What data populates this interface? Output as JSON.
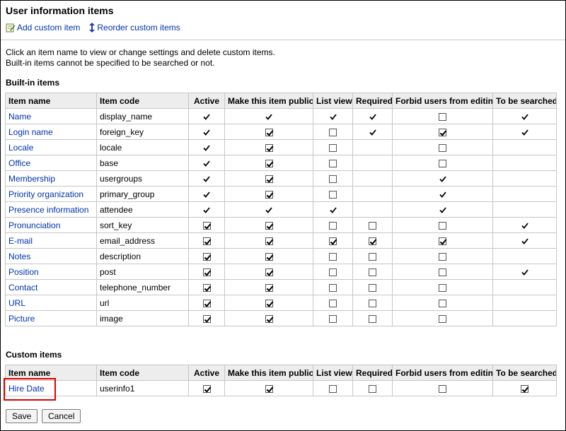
{
  "title": "User information items",
  "toolbar": {
    "add_label": "Add custom item",
    "reorder_label": "Reorder custom items"
  },
  "description": {
    "line1": "Click an item name to view or change settings and delete custom items.",
    "line2": "Built-in items cannot be specified to be searched or not."
  },
  "headers": [
    "Item name",
    "Item code",
    "Active",
    "Make this item public",
    "List view",
    "Required",
    "Forbid users from editing",
    "To be searched"
  ],
  "builtin": {
    "heading": "Built-in items",
    "rows": [
      {
        "name": "Name",
        "code": "display_name",
        "cells": [
          "tick",
          "tick",
          "tick",
          "tick",
          "cb",
          "tick"
        ]
      },
      {
        "name": "Login name",
        "code": "foreign_key",
        "cells": [
          "tick",
          "cb1",
          "cb0",
          "tick",
          "cb1",
          "tick"
        ]
      },
      {
        "name": "Locale",
        "code": "locale",
        "cells": [
          "tick",
          "cb1",
          "cb0",
          "",
          "cb0",
          ""
        ]
      },
      {
        "name": "Office",
        "code": "base",
        "cells": [
          "tick",
          "cb1",
          "cb0",
          "",
          "cb0",
          ""
        ]
      },
      {
        "name": "Membership",
        "code": "usergroups",
        "cells": [
          "tick",
          "cb1",
          "cb0",
          "",
          "tick",
          ""
        ]
      },
      {
        "name": "Priority organization",
        "code": "primary_group",
        "cells": [
          "tick",
          "cb1",
          "cb0",
          "",
          "tick",
          ""
        ]
      },
      {
        "name": "Presence information",
        "code": "attendee",
        "cells": [
          "tick",
          "tick",
          "tick",
          "",
          "tick",
          ""
        ]
      },
      {
        "name": "Pronunciation",
        "code": "sort_key",
        "cells": [
          "cb1",
          "cb1",
          "cb0",
          "cb0",
          "cb0",
          "tick"
        ]
      },
      {
        "name": "E-mail",
        "code": "email_address",
        "cells": [
          "cb1",
          "cb1",
          "cb1",
          "cb1",
          "cb1",
          "tick"
        ]
      },
      {
        "name": "Notes",
        "code": "description",
        "cells": [
          "cb1",
          "cb1",
          "cb0",
          "cb0",
          "cb0",
          ""
        ]
      },
      {
        "name": "Position",
        "code": "post",
        "cells": [
          "cb1",
          "cb1",
          "cb0",
          "cb0",
          "cb0",
          "tick"
        ]
      },
      {
        "name": "Contact",
        "code": "telephone_number",
        "cells": [
          "cb1",
          "cb1",
          "cb0",
          "cb0",
          "cb0",
          ""
        ]
      },
      {
        "name": "URL",
        "code": "url",
        "cells": [
          "cb1",
          "cb1",
          "cb0",
          "cb0",
          "cb0",
          ""
        ]
      },
      {
        "name": "Picture",
        "code": "image",
        "cells": [
          "cb1",
          "cb1",
          "cb0",
          "cb0",
          "cb0",
          ""
        ]
      }
    ]
  },
  "custom": {
    "heading": "Custom items",
    "rows": [
      {
        "name": "Hire Date",
        "code": "userinfo1",
        "cells": [
          "cb1",
          "cb1",
          "cb0",
          "cb0",
          "cb0",
          "cb1"
        ]
      }
    ]
  },
  "buttons": {
    "save": "Save",
    "cancel": "Cancel"
  },
  "colors": {
    "link": "#0033aa",
    "header_bg": "#ededed",
    "highlight": "#e00000"
  }
}
